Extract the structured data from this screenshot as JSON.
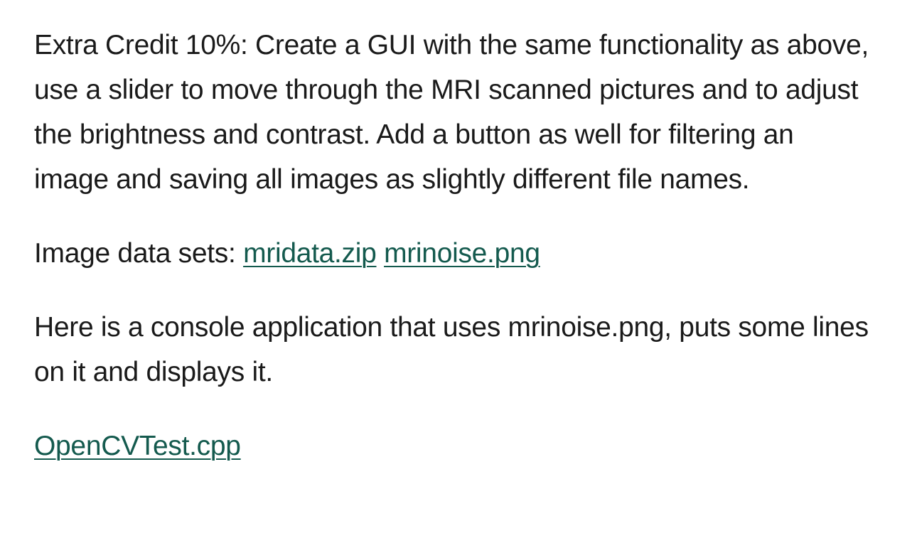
{
  "paragraphs": {
    "extra_credit": "Extra Credit 10%: Create a GUI with the same functionality as above, use a slider to move through the MRI scanned pictures and to adjust the brightness and contrast. Add a button as well for filtering an image and saving all images as slightly different file names.",
    "datasets_label": "Image data sets: ",
    "dataset_links": [
      "mridata.zip",
      "mrinoise.png"
    ],
    "console_app": "Here is a console application that uses mrinoise.png, puts some lines on it and displays it.",
    "source_link": "OpenCVTest.cpp"
  },
  "colors": {
    "text": "#1a1a1a",
    "link": "#145a4e",
    "background": "#ffffff"
  }
}
